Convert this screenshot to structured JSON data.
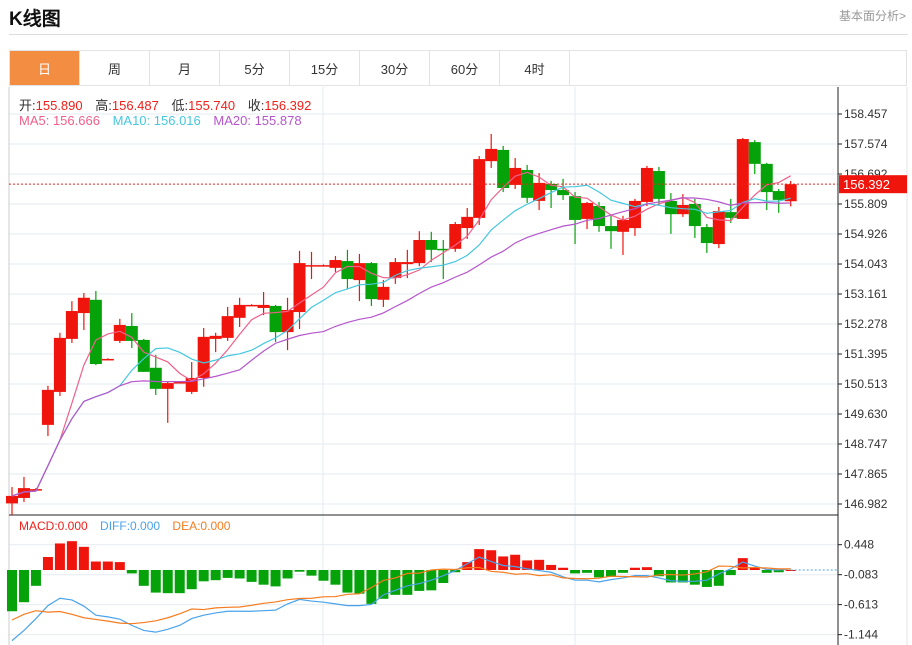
{
  "header": {
    "title": "K线图",
    "link": "基本面分析>"
  },
  "tabs": [
    {
      "label": "日",
      "active": true
    },
    {
      "label": "周"
    },
    {
      "label": "月"
    },
    {
      "label": "5分"
    },
    {
      "label": "15分"
    },
    {
      "label": "30分"
    },
    {
      "label": "60分"
    },
    {
      "label": "4时"
    }
  ],
  "ohlc_legend": {
    "open_label": "开:",
    "open": "155.890",
    "high_label": "高:",
    "high": "156.487",
    "low_label": "低:",
    "low": "155.740",
    "close_label": "收:",
    "close": "156.392"
  },
  "ma_legend": {
    "ma5": "MA5: 156.666",
    "ma10": "MA10: 156.016",
    "ma20": "MA20: 155.878"
  },
  "macd_legend": {
    "macd": "MACD:0.000",
    "diff": "DIFF:0.000",
    "dea": "DEA:0.000"
  },
  "colors": {
    "up": "#f0150c",
    "down": "#05a20a",
    "ma5": "#f0608a",
    "ma10": "#45c8e0",
    "ma20": "#b656cc",
    "diff": "#4aa3ea",
    "dea": "#f57c1f",
    "active_tab": "#f28d42"
  },
  "chart_data": [
    {
      "type": "candlestick",
      "y_ticks": [
        "158.457",
        "157.574",
        "156.692",
        "155.809",
        "154.926",
        "154.043",
        "153.161",
        "152.278",
        "151.395",
        "150.513",
        "149.630",
        "148.747",
        "147.865",
        "146.982"
      ],
      "ylim": [
        146.982,
        158.457
      ],
      "last_price": "156.392",
      "ma_periods": [
        5,
        10,
        20
      ],
      "candles": [
        [
          147.0,
          147.22,
          147.48,
          146.66
        ],
        [
          147.16,
          147.45,
          147.78,
          147.04
        ],
        [
          147.42,
          147.42,
          147.45,
          147.39
        ],
        [
          149.31,
          150.34,
          150.46,
          148.98
        ],
        [
          150.28,
          151.87,
          152.02,
          150.16
        ],
        [
          151.84,
          152.66,
          152.95,
          151.72
        ],
        [
          152.6,
          153.05,
          153.19,
          152.1
        ],
        [
          152.99,
          151.1,
          153.25,
          151.07
        ],
        [
          151.25,
          151.25,
          151.27,
          151.23
        ],
        [
          151.78,
          152.25,
          152.43,
          151.72
        ],
        [
          152.22,
          151.78,
          152.6,
          151.57
        ],
        [
          151.81,
          150.87,
          151.84,
          150.87
        ],
        [
          150.99,
          150.37,
          151.37,
          150.19
        ],
        [
          150.37,
          150.54,
          150.6,
          149.37
        ],
        [
          150.57,
          150.57,
          150.59,
          150.55
        ],
        [
          150.28,
          150.69,
          151.16,
          150.22
        ],
        [
          150.69,
          151.9,
          152.16,
          150.43
        ],
        [
          151.84,
          151.93,
          152.02,
          151.45
        ],
        [
          151.87,
          152.51,
          152.78,
          151.78
        ],
        [
          152.46,
          152.84,
          153.05,
          152.19
        ],
        [
          152.84,
          152.84,
          152.86,
          152.82
        ],
        [
          152.75,
          152.84,
          153.22,
          152.54
        ],
        [
          152.81,
          152.04,
          152.84,
          151.75
        ],
        [
          152.04,
          152.69,
          153.05,
          151.51
        ],
        [
          152.63,
          154.07,
          154.43,
          152.13
        ],
        [
          154.01,
          154.01,
          154.4,
          153.6
        ],
        [
          154.01,
          154.01,
          154.03,
          153.99
        ],
        [
          153.93,
          154.16,
          154.28,
          153.81
        ],
        [
          154.13,
          153.6,
          154.46,
          153.31
        ],
        [
          153.57,
          154.07,
          154.34,
          152.95
        ],
        [
          154.07,
          153.01,
          154.1,
          152.81
        ],
        [
          152.99,
          153.37,
          153.57,
          152.78
        ],
        [
          153.63,
          154.1,
          154.22,
          153.46
        ],
        [
          154.04,
          154.1,
          154.46,
          153.63
        ],
        [
          154.07,
          154.75,
          155.01,
          153.98
        ],
        [
          154.75,
          154.46,
          154.99,
          154.1
        ],
        [
          154.49,
          154.46,
          154.75,
          153.6
        ],
        [
          154.49,
          155.22,
          155.28,
          154.4
        ],
        [
          155.1,
          155.43,
          155.69,
          154.78
        ],
        [
          155.4,
          157.13,
          157.22,
          155.19
        ],
        [
          157.07,
          157.43,
          157.87,
          156.87
        ],
        [
          157.4,
          156.28,
          157.52,
          156.16
        ],
        [
          156.37,
          156.87,
          157.16,
          156.25
        ],
        [
          156.81,
          155.99,
          156.96,
          155.84
        ],
        [
          155.9,
          156.43,
          156.72,
          155.63
        ],
        [
          156.4,
          156.22,
          156.49,
          155.69
        ],
        [
          156.22,
          156.07,
          156.55,
          155.93
        ],
        [
          156.04,
          155.34,
          156.16,
          154.63
        ],
        [
          155.37,
          155.84,
          155.87,
          155.07
        ],
        [
          155.75,
          155.16,
          155.87,
          154.99
        ],
        [
          155.16,
          155.01,
          155.46,
          154.49
        ],
        [
          154.99,
          155.34,
          155.46,
          154.31
        ],
        [
          155.1,
          155.9,
          155.96,
          154.87
        ],
        [
          155.87,
          156.87,
          156.93,
          155.75
        ],
        [
          156.78,
          155.96,
          156.9,
          155.78
        ],
        [
          155.9,
          155.51,
          156.13,
          154.93
        ],
        [
          155.51,
          155.78,
          156.1,
          155.43
        ],
        [
          155.81,
          155.16,
          155.96,
          154.81
        ],
        [
          155.13,
          154.66,
          155.22,
          154.37
        ],
        [
          154.63,
          155.6,
          155.72,
          154.51
        ],
        [
          155.57,
          155.4,
          155.96,
          155.25
        ],
        [
          155.37,
          157.72,
          157.75,
          155.37
        ],
        [
          157.63,
          156.99,
          157.69,
          156.69
        ],
        [
          156.99,
          156.16,
          157.02,
          155.63
        ],
        [
          156.19,
          155.93,
          156.25,
          155.55
        ],
        [
          155.89,
          156.392,
          156.487,
          155.74
        ]
      ]
    },
    {
      "type": "bar+line",
      "y_ticks": [
        "0.448",
        "-0.083",
        "-0.613",
        "-1.144"
      ],
      "macd": [
        -0.73,
        -0.57,
        -0.28,
        0.23,
        0.47,
        0.51,
        0.41,
        0.15,
        0.15,
        0.14,
        -0.06,
        -0.28,
        -0.4,
        -0.41,
        -0.41,
        -0.34,
        -0.2,
        -0.18,
        -0.14,
        -0.15,
        -0.21,
        -0.26,
        -0.29,
        -0.15,
        -0.03,
        -0.1,
        -0.19,
        -0.26,
        -0.4,
        -0.42,
        -0.6,
        -0.51,
        -0.44,
        -0.44,
        -0.37,
        -0.36,
        -0.23,
        -0.04,
        0.14,
        0.37,
        0.35,
        0.24,
        0.27,
        0.17,
        0.18,
        0.09,
        0.04,
        -0.06,
        -0.05,
        -0.13,
        -0.12,
        -0.05,
        0.04,
        0.05,
        -0.11,
        -0.22,
        -0.22,
        -0.26,
        -0.3,
        -0.28,
        -0.09,
        0.21,
        0.05,
        -0.05,
        -0.04,
        0.0
      ],
      "diff": [
        -1.25,
        -1.07,
        -0.86,
        -0.63,
        -0.5,
        -0.53,
        -0.64,
        -0.8,
        -0.83,
        -0.87,
        -0.98,
        -1.07,
        -1.1,
        -1.05,
        -0.98,
        -0.86,
        -0.8,
        -0.76,
        -0.73,
        -0.73,
        -0.73,
        -0.72,
        -0.71,
        -0.6,
        -0.52,
        -0.55,
        -0.57,
        -0.6,
        -0.63,
        -0.63,
        -0.61,
        -0.44,
        -0.36,
        -0.28,
        -0.24,
        -0.18,
        -0.1,
        -0.01,
        0.11,
        0.23,
        0.15,
        0.08,
        0.06,
        0.02,
        -0.01,
        -0.04,
        -0.12,
        -0.18,
        -0.18,
        -0.21,
        -0.17,
        -0.14,
        -0.1,
        -0.1,
        -0.14,
        -0.19,
        -0.2,
        -0.2,
        -0.18,
        -0.07,
        0.02,
        0.14,
        0.07,
        0.01,
        0.0,
        0.02
      ]
    }
  ]
}
